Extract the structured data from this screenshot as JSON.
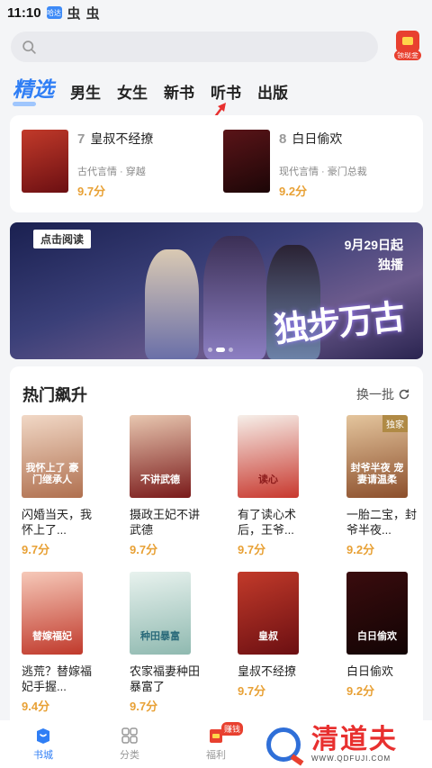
{
  "status_bar": {
    "time": "11:10",
    "app_badge": "哈达",
    "glyphs": [
      "虫",
      "虫"
    ]
  },
  "search": {
    "placeholder": ""
  },
  "welfare_button": {
    "label": "领现金"
  },
  "tabs": [
    {
      "label": "精选",
      "active": true
    },
    {
      "label": "男生"
    },
    {
      "label": "女生"
    },
    {
      "label": "新书"
    },
    {
      "label": "听书"
    },
    {
      "label": "出版"
    }
  ],
  "top_ranked": [
    {
      "rank": "7",
      "title": "皇叔不经撩",
      "tags": "古代言情 · 穿越",
      "score": "9.7分",
      "cover_color": "#9c1e1e"
    },
    {
      "rank": "8",
      "title": "白日偷欢",
      "tags": "现代言情 · 豪门总裁",
      "score": "9.2分",
      "cover_color": "#3a0c0e"
    }
  ],
  "banner": {
    "read_tag": "点击阅读",
    "date_line1": "9月29日起",
    "date_line2": "独播",
    "calligraphy": "独步万古"
  },
  "hot_section": {
    "title": "热门飙升",
    "refresh_label": "换一批",
    "books": [
      {
        "name": "闪婚当天，我怀上了...",
        "score": "9.7分",
        "cover_text": "我怀上了 豪门继承人",
        "cover_color": "#c98f7a",
        "badge": ""
      },
      {
        "name": "摄政王妃不讲武德",
        "score": "9.7分",
        "cover_text": "不讲武德",
        "cover_color": "#7a1a1a",
        "badge": ""
      },
      {
        "name": "有了读心术后，王爷...",
        "score": "9.7分",
        "cover_text": "读心",
        "cover_color": "#e8d6cf",
        "badge": ""
      },
      {
        "name": "一胎二宝，封爷半夜...",
        "score": "9.2分",
        "cover_text": "封爷半夜 宠妻请温柔",
        "cover_color": "#c88f63",
        "badge": "独家"
      },
      {
        "name": "逃荒？替嫁福妃手握...",
        "score": "9.4分",
        "cover_text": "替嫁福妃",
        "cover_color": "#e89f86",
        "badge": ""
      },
      {
        "name": "农家福妻种田暴富了",
        "score": "9.7分",
        "cover_text": "种田暴富",
        "cover_color": "#cfe3dc",
        "badge": ""
      },
      {
        "name": "皇叔不经撩",
        "score": "9.7分",
        "cover_text": "皇叔",
        "cover_color": "#9c1e1e",
        "badge": ""
      },
      {
        "name": "白日偷欢",
        "score": "9.2分",
        "cover_text": "白日偷欢",
        "cover_color": "#2a0b0c",
        "badge": ""
      }
    ]
  },
  "bottom_nav": [
    {
      "label": "书城",
      "icon": "book-store-icon",
      "active": true
    },
    {
      "label": "分类",
      "icon": "grid-icon"
    },
    {
      "label": "福利",
      "icon": "gift-icon",
      "badge": "赚钱"
    },
    {
      "label": "",
      "icon": ""
    },
    {
      "label": "",
      "icon": ""
    }
  ],
  "watermark": {
    "name": "清道夫",
    "url": "WWW.QDFUJI.COM"
  },
  "colors": {
    "accent": "#2f7ef5",
    "score": "#e8a136",
    "red": "#e8402f"
  }
}
